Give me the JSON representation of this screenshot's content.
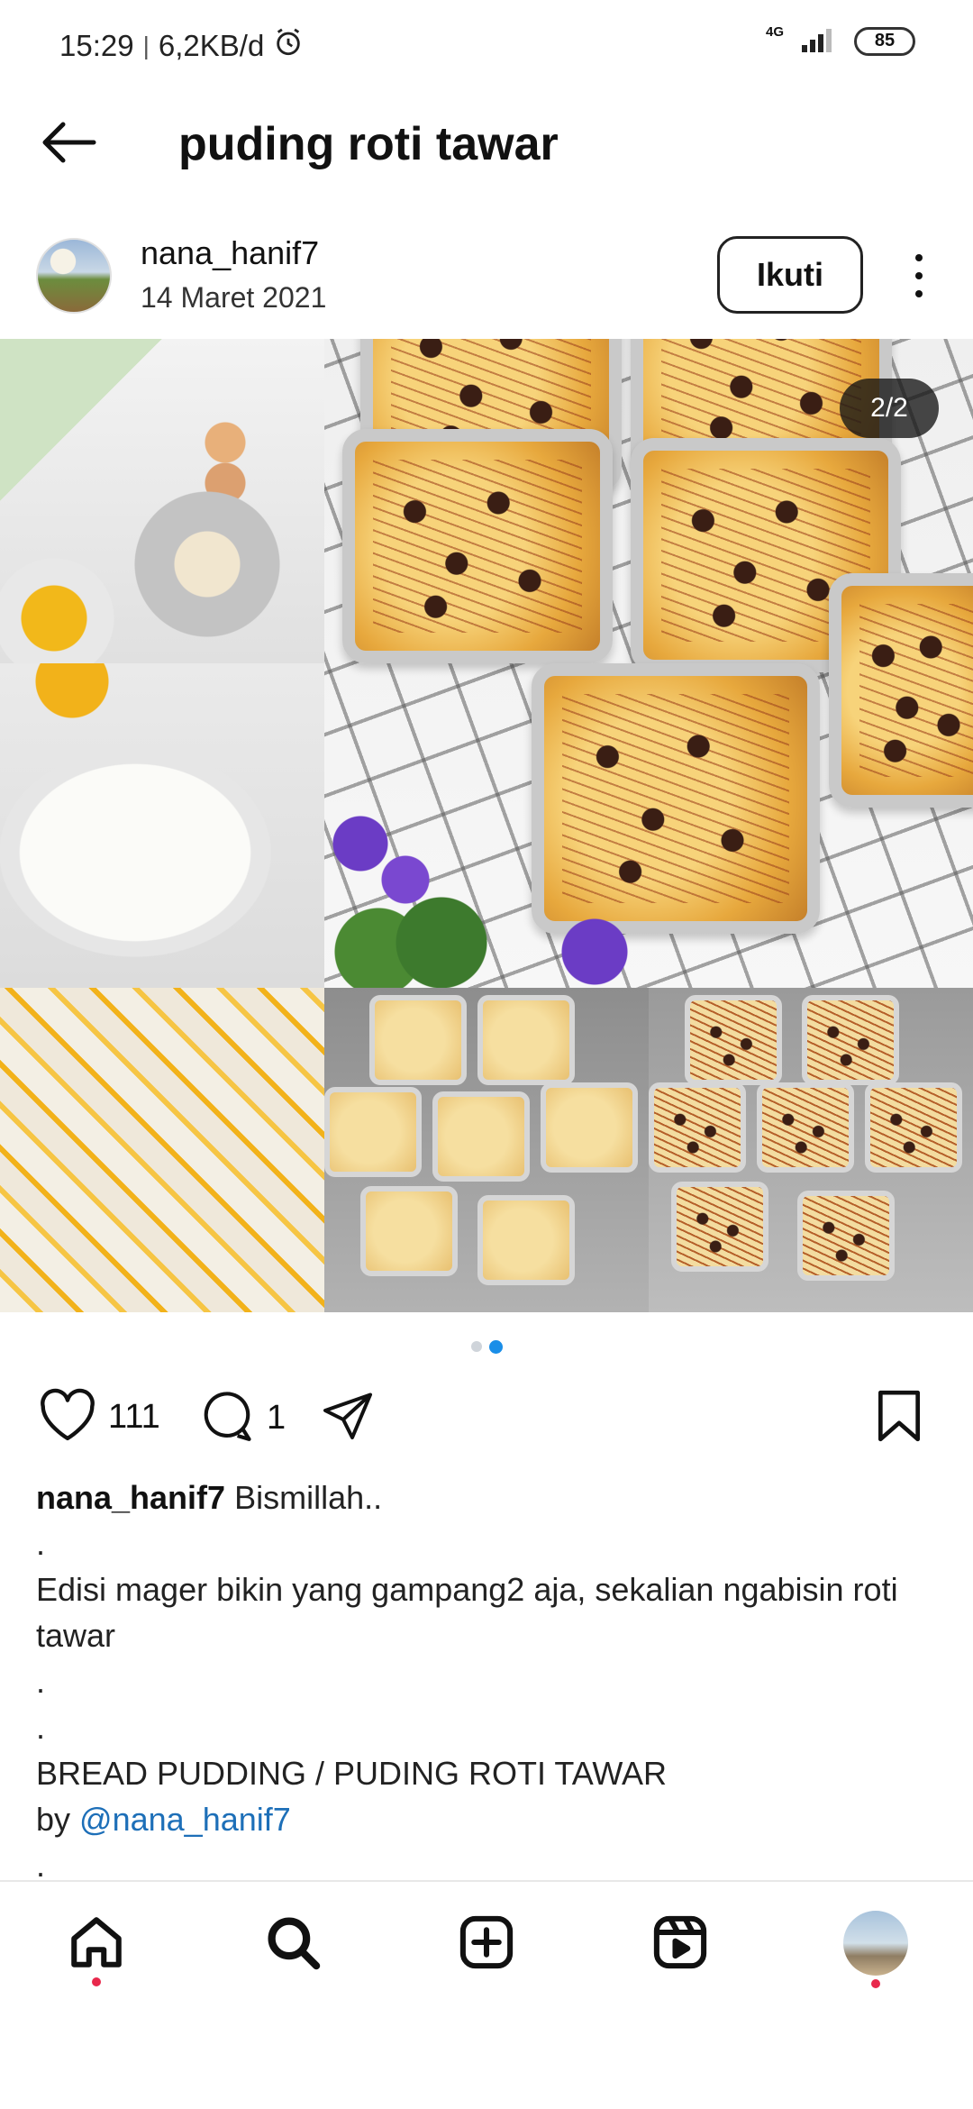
{
  "status_bar": {
    "time": "15:29",
    "separator": "|",
    "data_rate": "6,2KB/d",
    "network": "4G",
    "battery": "85"
  },
  "header": {
    "title": "puding roti tawar"
  },
  "post": {
    "username": "nana_hanif7",
    "date": "14 Maret 2021",
    "follow_label": "Ikuti",
    "image_counter": "2/2",
    "likes": "111",
    "comments": "1",
    "caption": {
      "username": "nana_hanif7",
      "line1": "Bismillah..",
      "dot": ".",
      "line2": "Edisi mager bikin yang gampang2 aja, sekalian ngabisin roti tawar",
      "title": "BREAD PUDDING / PUDING ROTI TAWAR",
      "by": "by",
      "mention": "@nana_hanif7"
    }
  },
  "icons": {
    "back": "arrow-left-icon",
    "more": "more-vertical-icon",
    "like": "heart-icon",
    "comment": "comment-icon",
    "share": "send-icon",
    "save": "bookmark-icon",
    "alarm": "alarm-icon",
    "signal": "signal-icon",
    "home": "home-icon",
    "search": "search-icon",
    "create": "plus-square-icon",
    "reels": "reels-icon"
  },
  "colors": {
    "accent_blue": "#1a8ee8",
    "mention_blue": "#1d6fb8",
    "notification_red": "#e8284c"
  }
}
